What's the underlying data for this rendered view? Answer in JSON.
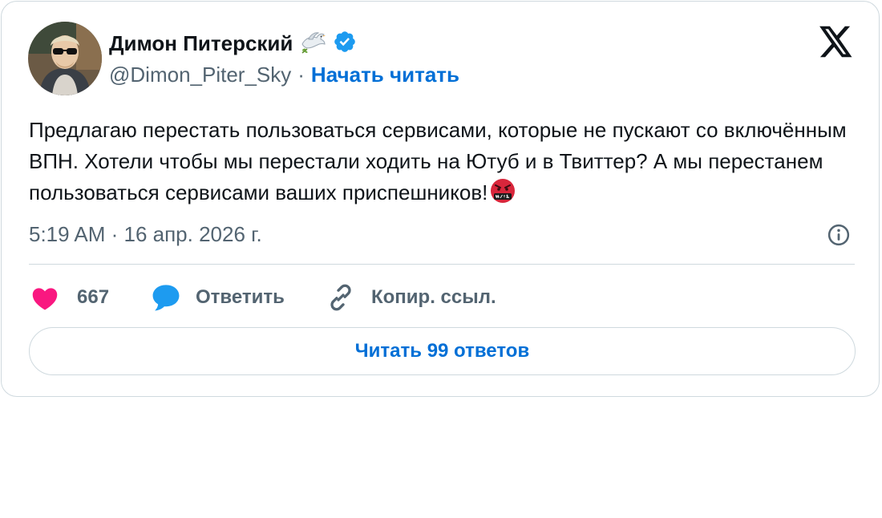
{
  "author": {
    "display_name": "Димон Питерский",
    "handle": "@Dimon_Piter_Sky",
    "separator": "·",
    "follow_label": "Начать читать",
    "verified": true,
    "name_emoji": "dove-with-olive-branch-icon"
  },
  "tweet": {
    "text": "Предлагаю перестать пользоваться сервисами, которые не пускают со включённым ВПН. Хотели чтобы мы перестали ходить на Ютуб и в Твиттер? А мы перестанем пользоваться сервисами ваших приспешников!",
    "trailing_emoji": "face-with-symbols-on-mouth-icon",
    "timestamp": "5:19 AM · 16 апр. 2026 г."
  },
  "actions": {
    "like_count": "667",
    "reply_label": "Ответить",
    "copy_link_label": "Копир. ссыл."
  },
  "read_replies_label": "Читать 99 ответов",
  "colors": {
    "accent": "#006fd6",
    "verified": "#1d9bf0",
    "like": "#f91880",
    "reply": "#1d9bf0",
    "secondary_text": "#536471",
    "border": "#cfd9de"
  }
}
